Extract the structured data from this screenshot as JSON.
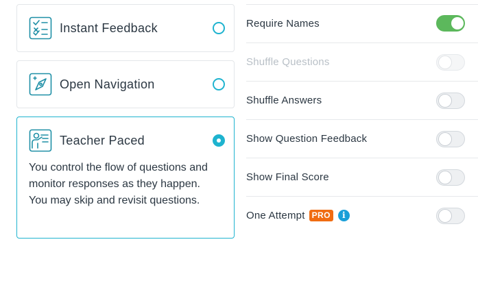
{
  "pacing_modes": [
    {
      "icon": "checklist-icon",
      "title": "Instant Feedback",
      "selected": false
    },
    {
      "icon": "compass-icon",
      "title": "Open Navigation",
      "selected": false
    },
    {
      "icon": "teacher-icon",
      "title": "Teacher Paced",
      "selected": true,
      "description": "You control the flow of questions and monitor responses as they happen. You may skip and revisit questions."
    }
  ],
  "settings": [
    {
      "label": "Require Names",
      "on": true,
      "enabled": true
    },
    {
      "label": "Shuffle Questions",
      "on": false,
      "enabled": false
    },
    {
      "label": "Shuffle Answers",
      "on": false,
      "enabled": true
    },
    {
      "label": "Show Question Feedback",
      "on": false,
      "enabled": true
    },
    {
      "label": "Show Final Score",
      "on": false,
      "enabled": true
    },
    {
      "label": "One Attempt",
      "on": false,
      "enabled": true,
      "badge": "PRO",
      "info_icon": "info-icon"
    }
  ],
  "colors": {
    "accent": "#1eb3cf",
    "toggle_on": "#5cb85c",
    "pro_badge": "#f06c12",
    "info": "#1a9fd8"
  }
}
